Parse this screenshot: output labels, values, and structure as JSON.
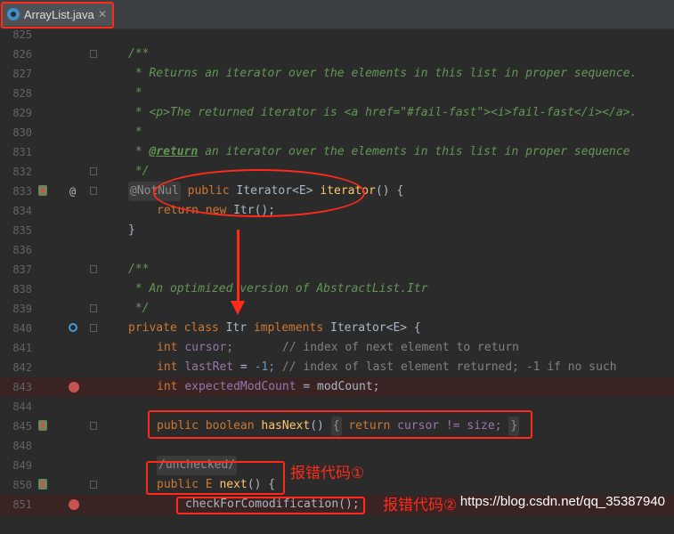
{
  "tab": {
    "title": "ArrayList.java",
    "close": "✕",
    "icon": "java-class-icon"
  },
  "lines": {
    "l825": "825",
    "l826": "826",
    "l827": "827",
    "l828": "828",
    "l829": "829",
    "l830": "830",
    "l831": "831",
    "l832": "832",
    "l833": "833",
    "l834": "834",
    "l835": "835",
    "l836": "836",
    "l837": "837",
    "l838": "838",
    "l839": "839",
    "l840": "840",
    "l841": "841",
    "l842": "842",
    "l843": "843",
    "l844": "844",
    "l845": "845",
    "l846": "848",
    "l849": "849",
    "l850": "850",
    "l851": "851"
  },
  "code": {
    "c826": "/**",
    "c827": " * Returns an iterator over the elements in this list in proper sequence.",
    "c828": " *",
    "c829": " * <p>The returned iterator is <a href=\"#fail-fast\"><i>fail-fast</i></a>.",
    "c830": " *",
    "c831_tag": "@return",
    "c831_rest": " an iterator over the elements in this list in proper sequence",
    "c832": " */",
    "c833_hint": "@NotNul",
    "c833_kw": "public",
    "c833_type": "Iterator<E>",
    "c833_fn": "iterator",
    "c833_rest": "() {",
    "c834_kw1": "return",
    "c834_kw2": "new",
    "c834_rest": "Itr();",
    "c835": "}",
    "c837": "/**",
    "c838": " * An optimized version of AbstractList.Itr",
    "c839": " */",
    "c840_kw": "private class",
    "c840_name": "Itr",
    "c840_kw2": "implements",
    "c840_rest": "Iterator<E> {",
    "c841_kw": "int",
    "c841_var": "cursor;",
    "c841_cm": "// index of next element to return",
    "c842_kw": "int",
    "c842_var": "lastRet",
    "c842_eq": " = ",
    "c842_num": "-1;",
    "c842_cm": "// index of last element returned; -1 if no such",
    "c843_kw": "int",
    "c843_var": "expectedModCount",
    "c843_rest": " = modCount;",
    "c845_kw": "public boolean",
    "c845_fn": "hasNext",
    "c845_p": "()",
    "c845_b1": "{",
    "c845_kw2": "return",
    "c845_rest": "cursor != size;",
    "c845_b2": "}",
    "c849_hint": "/unchecked/",
    "c850_kw": "public",
    "c850_type": "E",
    "c850_fn": "next",
    "c850_rest": "() {",
    "c851": "checkForComodification();"
  },
  "annotations": {
    "error1": "报错代码①",
    "error2": "报错代码②"
  },
  "watermark": "https://blog.csdn.net/qq_35387940",
  "colors": {
    "annotation_red": "#ff2a1a",
    "breakpoint": "#c75450"
  }
}
